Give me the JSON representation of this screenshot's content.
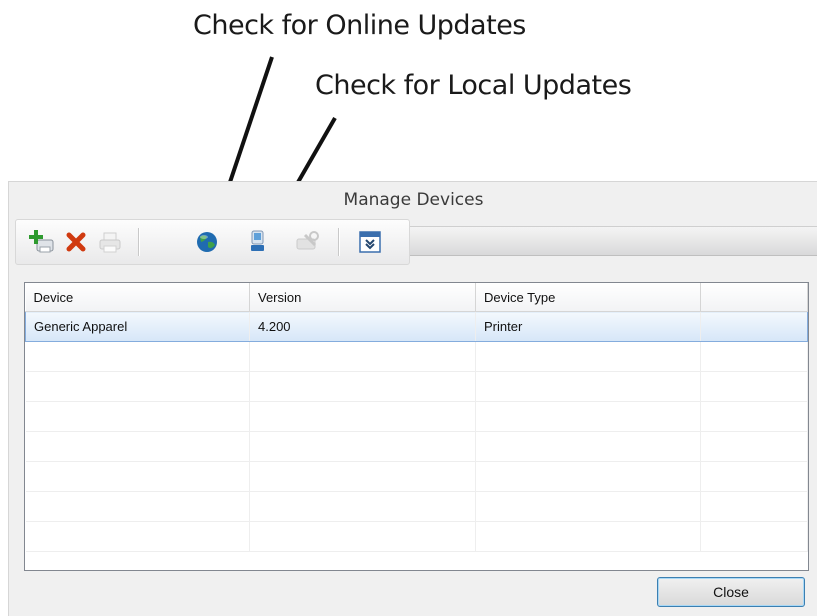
{
  "annotations": {
    "online": "Check for Online Updates",
    "local": "Check for Local Updates"
  },
  "window": {
    "title": "Manage Devices"
  },
  "toolbar": {
    "buttons": [
      {
        "icon": "add-device-icon",
        "enabled": true
      },
      {
        "icon": "delete-icon",
        "enabled": true
      },
      {
        "icon": "printer-icon",
        "enabled": false
      },
      {
        "icon": "globe-icon",
        "enabled": true
      },
      {
        "icon": "local-update-icon",
        "enabled": true
      },
      {
        "icon": "configure-icon",
        "enabled": false
      },
      {
        "icon": "expand-panel-icon",
        "enabled": true
      }
    ]
  },
  "grid": {
    "columns": [
      "Device",
      "Version",
      "Device Type",
      ""
    ],
    "rows": [
      {
        "device": "Generic Apparel",
        "version": "4.200",
        "type": "Printer",
        "selected": true
      }
    ],
    "empty_rows": 7
  },
  "buttons": {
    "close": "Close"
  },
  "colors": {
    "selection": "#d6e6f8",
    "selection_border": "#84acdd",
    "delete_icon": "#d03a10",
    "globe_icon": "#1f6bb0",
    "default_button_border": "#3c7fb1"
  }
}
